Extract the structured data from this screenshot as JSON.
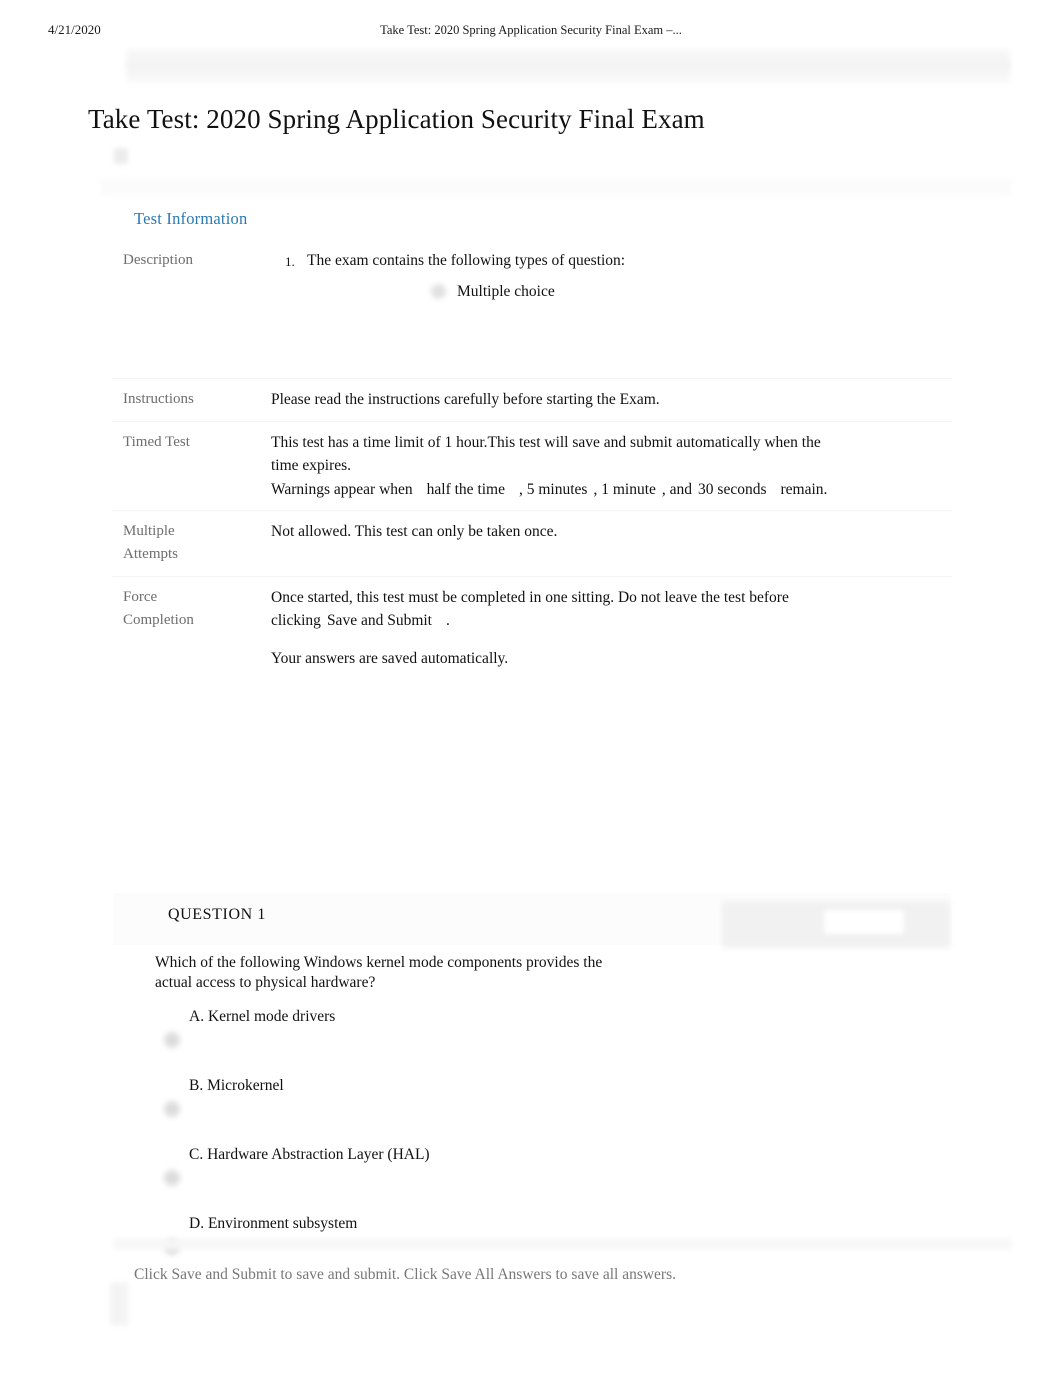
{
  "print_header": {
    "date": "4/21/2020",
    "document_title": "Take Test: 2020 Spring Application Security Final Exam –..."
  },
  "page": {
    "title": "Take Test: 2020 Spring Application Security Final Exam"
  },
  "test_information": {
    "heading": "Test Information",
    "accent_color": "#2a7ab0",
    "label_color": "#6e6e6e",
    "rows": [
      {
        "label": "Description",
        "list_number": "1.",
        "list_item": "The exam contains the following types of question:",
        "sub_item": "Multiple choice"
      },
      {
        "label": "Instructions",
        "value": "Please read the instructions carefully before starting the Exam."
      },
      {
        "label": "Timed Test",
        "line1": "This test has a time limit of 1 hour.This test will save and submit automatically when the",
        "line2": "time expires.",
        "warn_prefix": "Warnings appear when",
        "warn_half": "half the time",
        "warn_5min": ", 5 minutes",
        "warn_1min": ", 1 minute",
        "warn_and": ", and",
        "warn_30sec": "30 seconds",
        "warn_suffix": "remain."
      },
      {
        "label": "Multiple Attempts",
        "label_line1": "Multiple",
        "label_line2": "Attempts",
        "value": "Not allowed. This test can only be taken once."
      },
      {
        "label": "Force Completion",
        "label_line1": "Force",
        "label_line2": "Completion",
        "line1": "Once started, this test must be completed in one sitting. Do not leave the test before",
        "line2_prefix": "clicking",
        "line2_button": "Save and Submit",
        "line2_suffix": ".",
        "line3": "Your answers are saved automatically."
      }
    ]
  },
  "question": {
    "number_label": "QUESTION 1",
    "text_line1": "Which of the following Windows kernel mode components provides the",
    "text_line2": "actual access to physical hardware?",
    "answers": [
      {
        "letter": "A.",
        "text": "Kernel mode drivers",
        "label": "A. Kernel mode drivers",
        "selected": false
      },
      {
        "letter": "B.",
        "text": "Microkernel",
        "label": "B. Microkernel",
        "selected": false
      },
      {
        "letter": "C.",
        "text": "Hardware Abstraction Layer (HAL)",
        "label": "C. Hardware Abstraction Layer (HAL)",
        "selected": false
      },
      {
        "letter": "D.",
        "text": "Environment subsystem",
        "label": "D. Environment subsystem",
        "selected": false
      }
    ]
  },
  "footer": {
    "note": "Click Save and Submit to save and submit. Click Save All Answers to save all answers."
  }
}
